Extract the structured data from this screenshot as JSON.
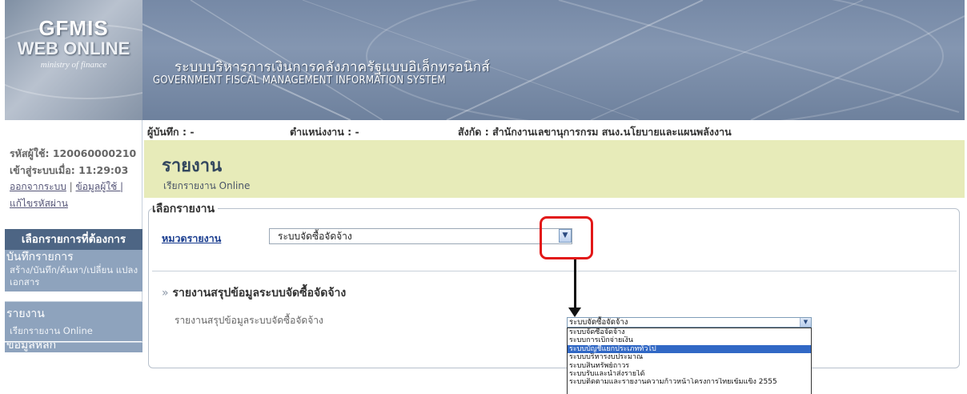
{
  "header": {
    "logo_line1": "GFMIS",
    "logo_line2": "WEB ONLINE",
    "logo_line3": "ministry of finance",
    "title_thai": "ระบบบริหารการเงินการคลังภาครัฐแบบอิเล็กทรอนิกส์",
    "title_eng": "GOVERNMENT FISCAL MANAGEMENT INFORMATION SYSTEM"
  },
  "sidebar": {
    "user_id_label": "รหัสผู้ใช้: 120060000210",
    "login_label": "เข้าสู่ระบบเมื่อ: 11:29:03",
    "link_logout": "ออกจากระบบ",
    "link_sep": " | ",
    "link_userinfo": "ข้อมูลผู้ใช้ |",
    "link_changepw": "แก้ไขรหัสผ่าน",
    "menu_title": "เลือกรายการที่ต้องการ",
    "items": [
      {
        "title": "บันทึกรายการ",
        "sub": "สร้าง/บันทึก/ค้นหา/เปลี่ยน แปลง เอกสาร"
      },
      {
        "title": "รายงาน",
        "sub": "เรียกรายงาน Online"
      },
      {
        "title": "ข้อมูลหลัก",
        "sub": ""
      }
    ]
  },
  "info_strip": {
    "recorder": "ผู้บันทึก : -",
    "position": "ตำแหน่งงาน : -",
    "affiliation": "สังกัด : สำนักงานเลขานุการกรม สนง.นโยบายและแผนพลังงาน"
  },
  "page": {
    "title": "รายงาน",
    "subtitle": "เรียกรายงาน Online"
  },
  "panel": {
    "legend": "เลือกรายงาน",
    "category_label": "หมวดรายงาน",
    "category_value": "ระบบจัดซื้อจัดจ้าง",
    "section_bullet": "»",
    "section_title": "รายงานสรุปข้อมูลระบบจัดซื้อจัดจ้าง",
    "report_label": "รายงานสรุปข้อมูลระบบจัดซื้อจัดจ้าง"
  },
  "dropdown": {
    "selected": "ระบบจัดซื้อจัดจ้าง",
    "options": [
      "ระบบจัดซื้อจัดจ้าง",
      "ระบบการเบิกจ่ายเงิน",
      "ระบบบัญชีแยกประเภททั่วไป",
      "ระบบบริหารงบประมาณ",
      "ระบบสินทรัพย์ถาวร",
      "ระบบรับและนำส่งรายได้",
      "ระบบติดตามและรายงานความก้าวหน้าโครงการไทยเข้มแข็ง 2555"
    ],
    "highlighted_index": 2
  }
}
